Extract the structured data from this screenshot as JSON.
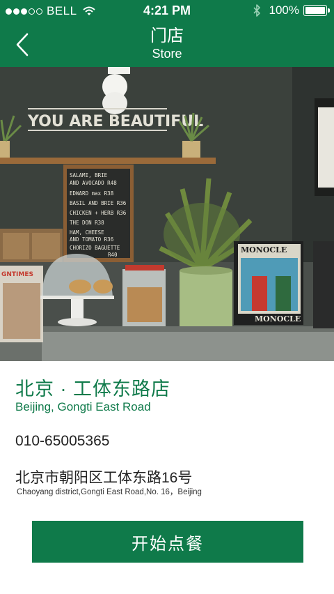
{
  "status_bar": {
    "carrier": "BELL",
    "time": "4:21 PM",
    "battery": "100%",
    "signal_icon": "signal-dots-icon",
    "wifi_icon": "wifi-icon",
    "bluetooth_icon": "bluetooth-icon",
    "battery_icon": "battery-icon",
    "battery_level": 1.0
  },
  "nav": {
    "title": "门店",
    "subtitle": "Store",
    "back_icon": "chevron-left-icon"
  },
  "photo": {
    "wall_sign": "YOU ARE BEAUTIFUL",
    "menu_board": [
      "SALAMI, BRIE",
      "AND AVOCADO R48",
      "EDWARD max R38",
      "BASIL AND BRIE R36",
      "CHICKEN + HERB R36",
      "THE DON R38",
      "HAM, CHEESE",
      "AND TOMATO R36",
      "CHORIZO BAGUETTE",
      "R40"
    ],
    "magazine": "MONOCLE",
    "shelf_sign": "GNTIMES"
  },
  "store": {
    "name": "北京 · 工体东路店",
    "name_en": "Beijing, Gongti East Road",
    "phone": "010-65005365",
    "address": "北京市朝阳区工体东路16号",
    "address_en": "Chaoyang district,Gongti East Road,No. 16，Beijing"
  },
  "actions": {
    "order_label": "开始点餐"
  },
  "colors": {
    "brand_green": "#0f7a4a",
    "text_dark": "#222222"
  }
}
